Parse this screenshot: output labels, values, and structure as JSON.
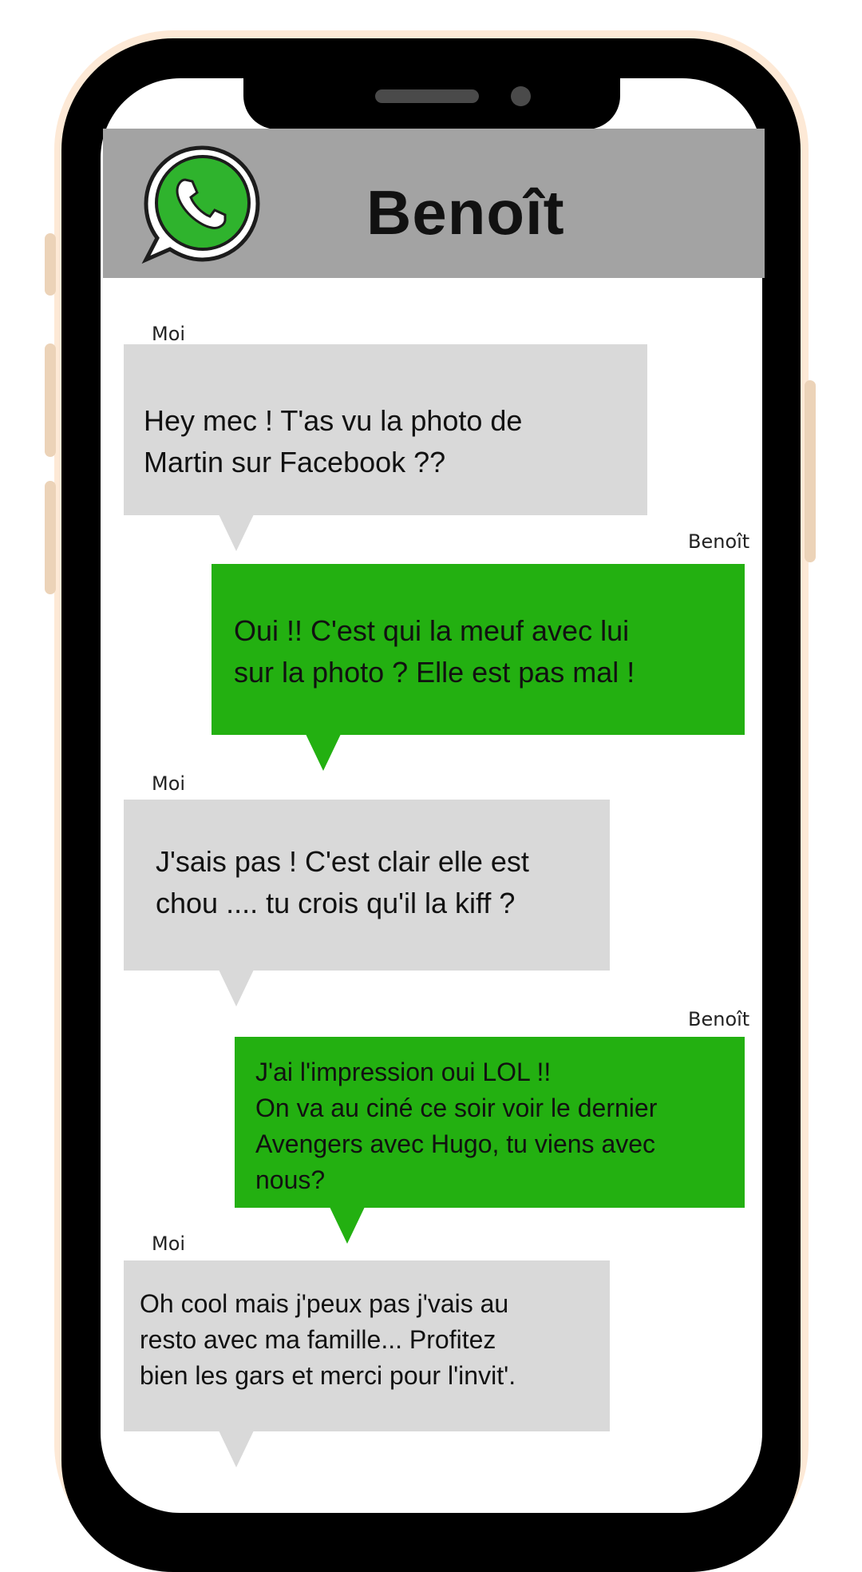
{
  "header": {
    "contact_name": "Benoît",
    "logo_icon": "whatsapp-icon"
  },
  "colors": {
    "header_bg": "#a3a3a3",
    "incoming_bubble": "#d9d9d9",
    "outgoing_bubble": "#23b011"
  },
  "messages": [
    {
      "sender": "Moi",
      "text": "Hey mec ! T'as vu la photo de\nMartin sur Facebook ??"
    },
    {
      "sender": "Benoît",
      "text": "  Oui  !! C'est  qui  la  meuf  avec  lui\nsur la photo ? Elle est pas mal !"
    },
    {
      "sender": "Moi",
      "text": "J'sais pas ! C'est clair elle est\nchou .... tu crois qu'il la kiff ?"
    },
    {
      "sender": "Benoît",
      "text": "J'ai l'impression oui LOL !!\nOn va au ciné ce soir voir le dernier\nAvengers avec Hugo, tu viens avec\nnous?"
    },
    {
      "sender": "Moi",
      "text": "Oh cool mais j'peux pas j'vais au\nresto avec ma famille... Profitez\nbien les gars  et merci pour l'invit'."
    }
  ]
}
